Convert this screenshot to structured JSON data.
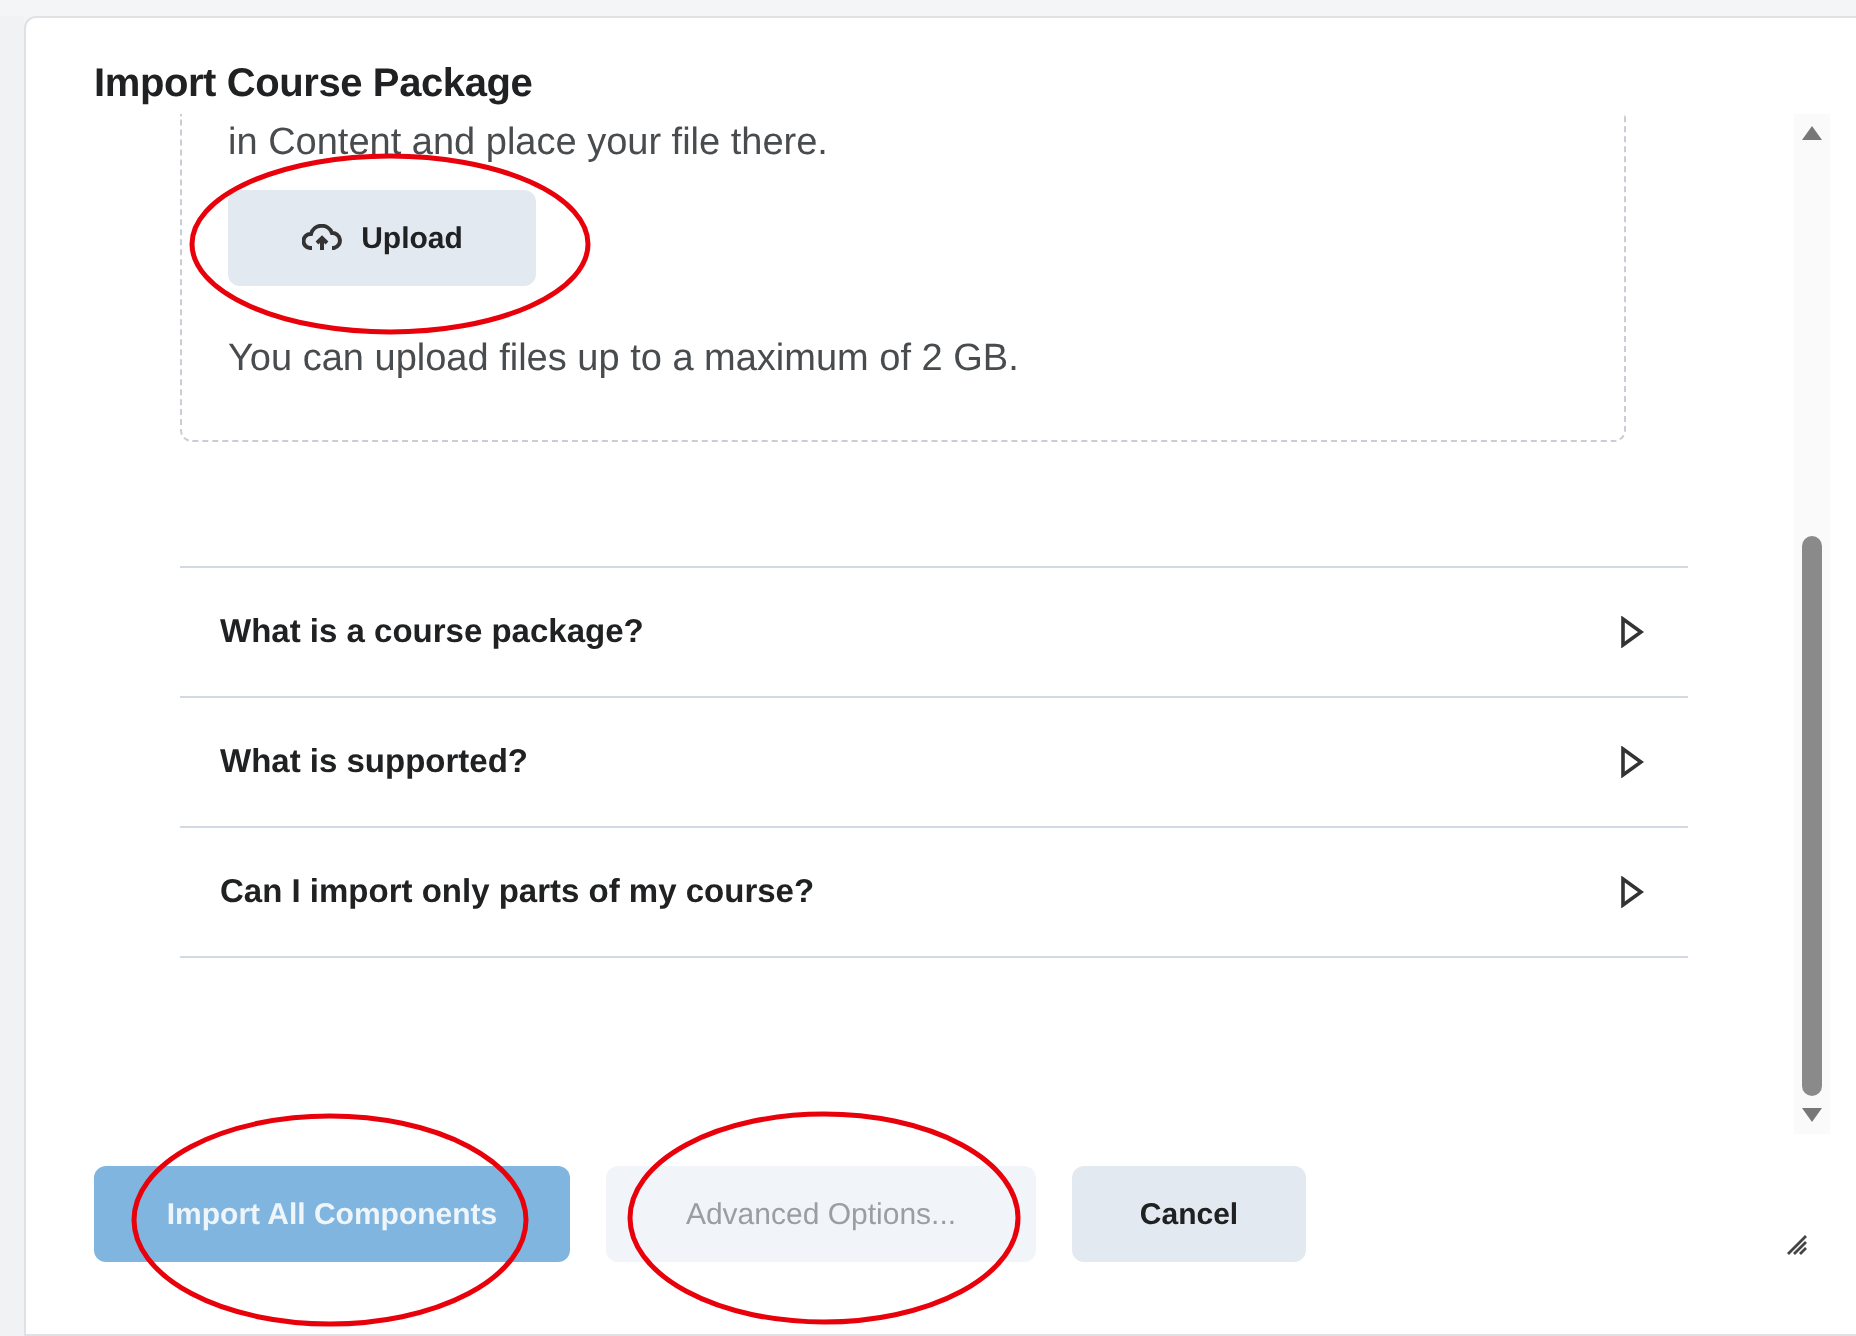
{
  "dialog": {
    "title": "Import Course Package",
    "dropzone": {
      "instruction": "in Content and place your file there.",
      "upload_button": "Upload",
      "limit_note": "You can upload files up to a maximum of 2 GB."
    },
    "faq": [
      {
        "question": "What is a course package?",
        "expanded": false
      },
      {
        "question": "What is supported?",
        "expanded": false
      },
      {
        "question": "Can I import only parts of my course?",
        "expanded": false
      }
    ],
    "buttons": [
      {
        "label": "Import All Components",
        "kind": "primary",
        "disabled": true
      },
      {
        "label": "Advanced Options...",
        "kind": "secondary",
        "disabled": true
      },
      {
        "label": "Cancel",
        "kind": "secondary",
        "disabled": false
      }
    ]
  }
}
